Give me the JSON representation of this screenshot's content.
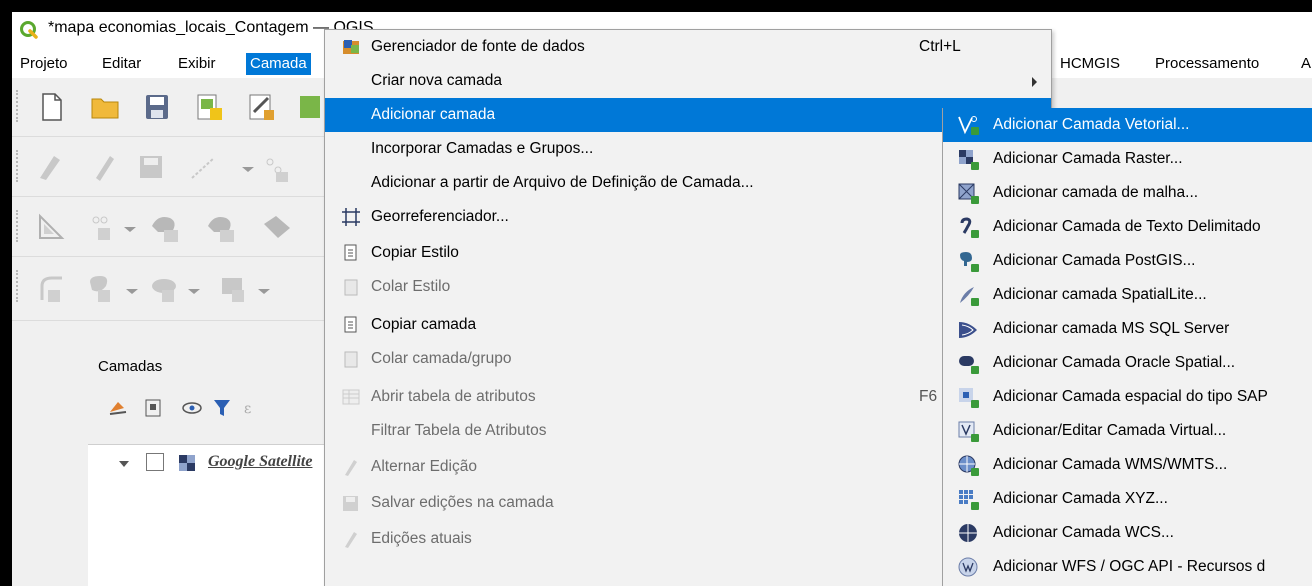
{
  "window": {
    "title": "*mapa economias_locais_Contagem — QGIS"
  },
  "menubar": {
    "items": [
      "Projeto",
      "Editar",
      "Exibir",
      "Camada"
    ],
    "right_items": [
      "HCMGIS",
      "Processamento",
      "A"
    ]
  },
  "layers_panel": {
    "title": "Camadas",
    "layer_name": "Google Satellite"
  },
  "layer_menu": {
    "items": [
      {
        "label": "Gerenciador de fonte de dados",
        "shortcut": "Ctrl+L"
      },
      {
        "label": "Criar nova camada"
      },
      {
        "label": "Adicionar camada"
      },
      {
        "label": "Incorporar Camadas e Grupos..."
      },
      {
        "label": "Adicionar a partir de Arquivo de Definição de Camada..."
      },
      {
        "label": "Georreferenciador..."
      },
      {
        "label": "Copiar Estilo"
      },
      {
        "label": "Colar Estilo"
      },
      {
        "label": "Copiar camada"
      },
      {
        "label": "Colar camada/grupo"
      },
      {
        "label": "Abrir tabela de atributos",
        "shortcut": "F6"
      },
      {
        "label": "Filtrar Tabela de Atributos"
      },
      {
        "label": "Alternar Edição"
      },
      {
        "label": "Salvar edições na camada"
      },
      {
        "label": "Edições atuais"
      }
    ]
  },
  "add_layer_submenu": {
    "items": [
      "Adicionar Camada Vetorial...",
      "Adicionar Camada Raster...",
      "Adicionar camada de malha...",
      "Adicionar Camada de Texto Delimitado",
      "Adicionar Camada PostGIS...",
      "Adicionar camada SpatialLite...",
      "Adicionar camada MS SQL Server",
      "Adicionar Camada Oracle Spatial...",
      "Adicionar Camada espacial do tipo SAP",
      "Adicionar/Editar Camada Virtual...",
      "Adicionar Camada WMS/WMTS...",
      "Adicionar Camada XYZ...",
      "Adicionar Camada WCS...",
      "Adicionar WFS / OGC API - Recursos d"
    ]
  },
  "colors": {
    "highlight": "#0078d7",
    "menu_bg": "#f2f2f2"
  }
}
